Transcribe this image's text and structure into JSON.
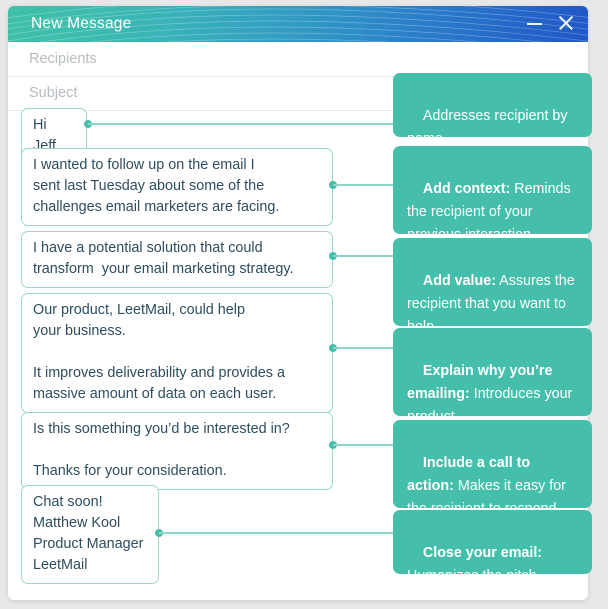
{
  "window": {
    "title": "New Message",
    "minimize_icon": "minimize-icon",
    "close_icon": "close-icon"
  },
  "fields": [
    {
      "name": "recipients",
      "placeholder": "Recipients",
      "value": ""
    },
    {
      "name": "subject",
      "placeholder": "Subject",
      "value": ""
    }
  ],
  "bubbles": [
    {
      "id": "greeting",
      "text": "Hi Jeff,"
    },
    {
      "id": "context",
      "text": "I wanted to follow up on the email I\nsent last Tuesday about some of the\nchallenges email marketers are facing."
    },
    {
      "id": "value",
      "text": "I have a potential solution that could\ntransform  your email marketing strategy."
    },
    {
      "id": "product",
      "text": "Our product, LeetMail, could help\nyour business.\n\nIt improves deliverability and provides a\nmassive amount of data on each user."
    },
    {
      "id": "cta",
      "text": "Is this something you’d be interested in?\n\nThanks for your consideration."
    },
    {
      "id": "signature",
      "text": "Chat soon!\nMatthew Kool\nProduct Manager\nLeetMail"
    }
  ],
  "notes": [
    {
      "id": "note-greeting",
      "bold": "",
      "text": "Addresses recipient by name"
    },
    {
      "id": "note-context",
      "bold": "Add context:",
      "text": " Reminds the recipient of your previous interaction"
    },
    {
      "id": "note-value",
      "bold": "Add value:",
      "text": " Assures the recipient that you want to help"
    },
    {
      "id": "note-product",
      "bold": "Explain why you’re emailing:",
      "text": " Introduces your product"
    },
    {
      "id": "note-cta",
      "bold": "Include a call to action:",
      "text": " Makes it easy for the recipient to respond"
    },
    {
      "id": "note-signature",
      "bold": "Close your email:",
      "text": " Humanizes the pitch"
    }
  ],
  "colors": {
    "accent_teal": "#45bfab",
    "bubble_border": "#9bd9cd",
    "text_dark": "#2e4d60",
    "placeholder": "#b7bcc0",
    "header_gradient_start": "#3fc0a8",
    "header_gradient_end": "#2157c6",
    "page_background": "#e8e8e8"
  }
}
